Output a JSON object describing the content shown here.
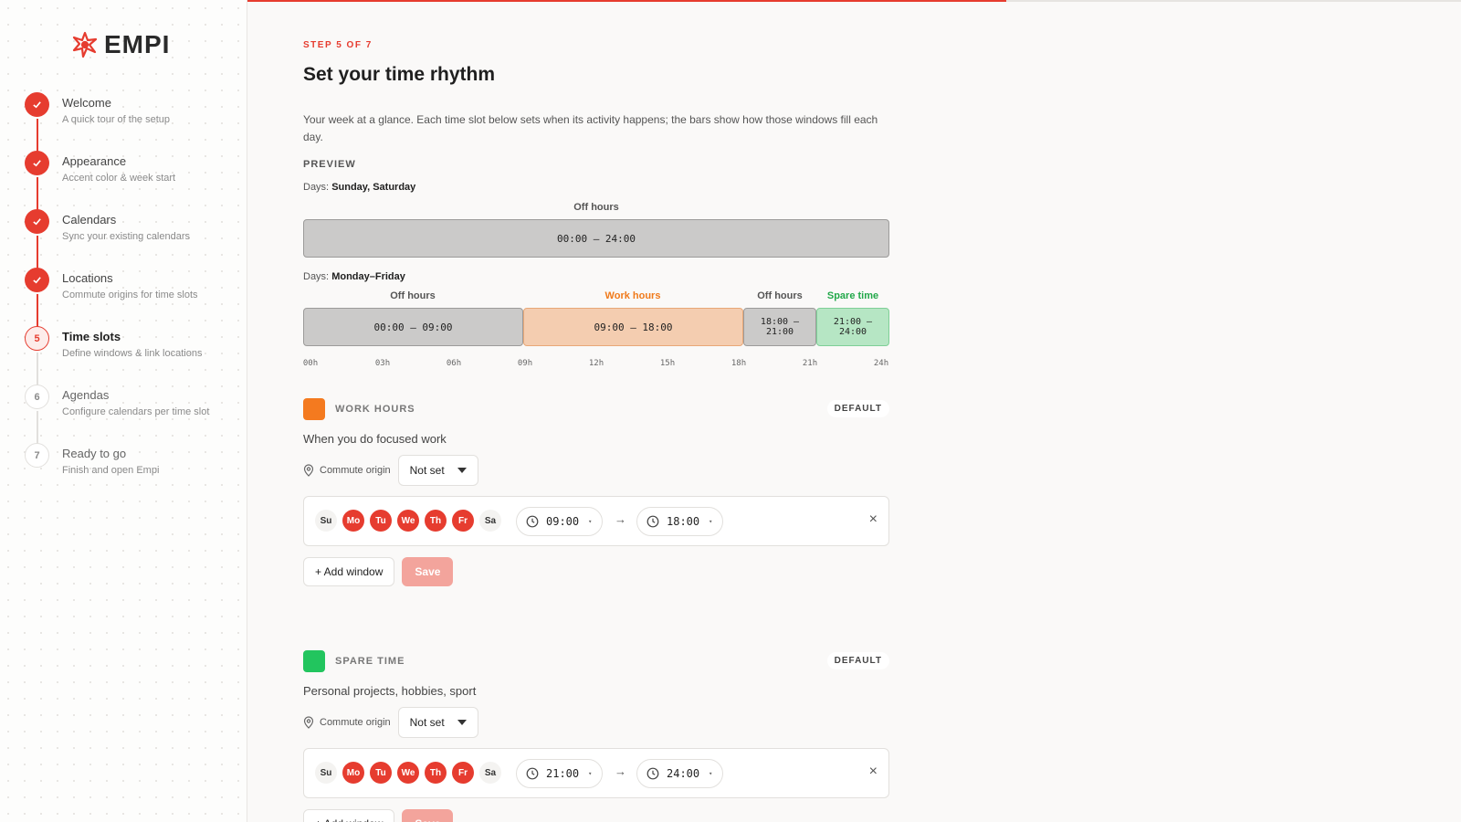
{
  "brand": {
    "name": "EMPI",
    "accent": "#e63c2f"
  },
  "progress": {
    "fraction": 0.625
  },
  "sidebar": {
    "steps": [
      {
        "number": "1",
        "title": "Welcome",
        "subtitle": "A quick tour of the setup",
        "status": "done"
      },
      {
        "number": "2",
        "title": "Appearance",
        "subtitle": "Accent color & week start",
        "status": "done"
      },
      {
        "number": "3",
        "title": "Calendars",
        "subtitle": "Sync your existing calendars",
        "status": "done"
      },
      {
        "number": "4",
        "title": "Locations",
        "subtitle": "Commute origins for time slots",
        "status": "done"
      },
      {
        "number": "5",
        "title": "Time slots",
        "subtitle": "Define windows & link locations",
        "status": "current"
      },
      {
        "number": "6",
        "title": "Agendas",
        "subtitle": "Configure calendars per time slot",
        "status": "todo"
      },
      {
        "number": "7",
        "title": "Ready to go",
        "subtitle": "Finish and open Empi",
        "status": "todo"
      }
    ]
  },
  "main": {
    "step_label": "STEP 5 OF 7",
    "title": "Set your time rhythm",
    "description": "Your week at a glance. Each time slot below sets when its activity happens; the bars show how those windows fill each day.",
    "preview_label": "PREVIEW",
    "days_prefix": "Days:",
    "weekend": {
      "days": "Sunday, Saturday",
      "labels": [
        {
          "text": "Off hours",
          "color": "#555555"
        }
      ],
      "segments": [
        {
          "range": "00:00 – 24:00",
          "kind": "off"
        }
      ]
    },
    "weekday": {
      "days": "Monday–Friday",
      "labels": [
        {
          "text": "Off hours",
          "color": "#555555"
        },
        {
          "text": "Work hours",
          "color": "#f07a1a"
        },
        {
          "text": "Off hours",
          "color": "#555555"
        },
        {
          "text": "Spare time",
          "color": "#22a84a"
        }
      ],
      "segments": [
        {
          "range": "00:00 – 09:00",
          "kind": "off"
        },
        {
          "range": "09:00 – 18:00",
          "kind": "work"
        },
        {
          "range_line1": "18:00 –",
          "range_line2": "21:00",
          "kind": "off"
        },
        {
          "range_line1": "21:00 –",
          "range_line2": "24:00",
          "kind": "spare"
        }
      ]
    },
    "axis_ticks": [
      "00h",
      "03h",
      "06h",
      "09h",
      "12h",
      "15h",
      "18h",
      "21h",
      "24h"
    ]
  },
  "slots": [
    {
      "name": "WORK HOURS",
      "color": "#f47a1f",
      "badge": "DEFAULT",
      "description": "When you do focused work",
      "commute_label": "Commute origin",
      "commute_value": "Not set",
      "days": [
        "Su",
        "Mo",
        "Tu",
        "We",
        "Th",
        "Fr",
        "Sa"
      ],
      "start": "09:00",
      "end": "18:00",
      "add_label": "+ Add window",
      "save_label": "Save"
    },
    {
      "name": "SPARE TIME",
      "color": "#22c55e",
      "badge": "DEFAULT",
      "description": "Personal projects, hobbies, sport",
      "commute_label": "Commute origin",
      "commute_value": "Not set",
      "days": [
        "Su",
        "Mo",
        "Tu",
        "We",
        "Th",
        "Fr",
        "Sa"
      ],
      "start": "21:00",
      "end": "24:00",
      "add_label": "+ Add window",
      "save_label": "Save"
    }
  ]
}
